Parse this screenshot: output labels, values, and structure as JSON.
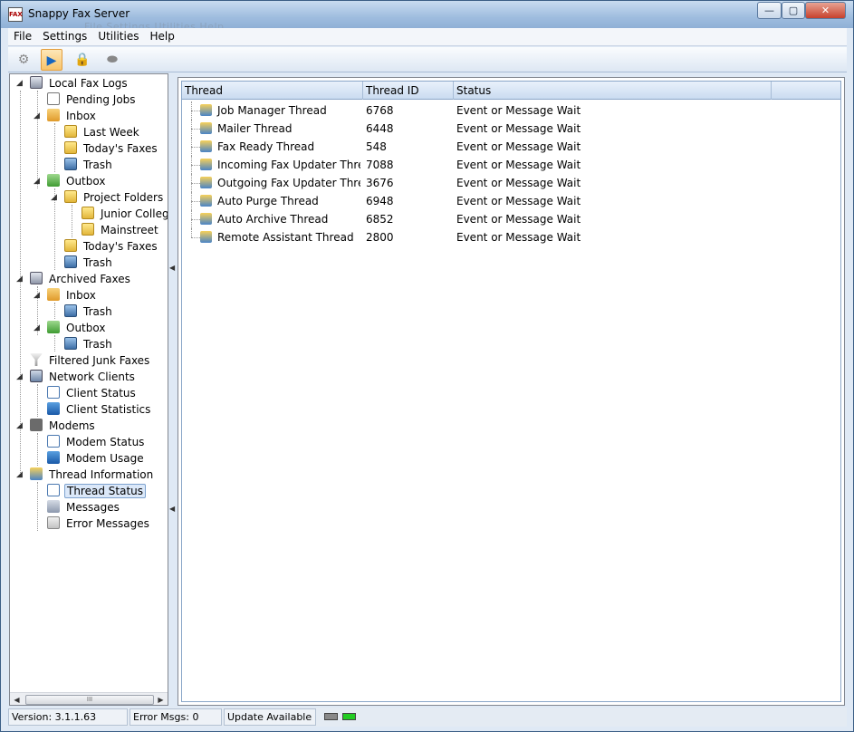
{
  "window": {
    "title": "Snappy Fax Server",
    "icon": "fax-icon",
    "title_ghost": "File  Settings  Utilities  Help"
  },
  "menu": [
    "File",
    "Settings",
    "Utilities",
    "Help"
  ],
  "toolbar": [
    {
      "icon": "gear-icon",
      "glyph": "⚙"
    },
    {
      "icon": "play-icon",
      "glyph": "▶"
    },
    {
      "icon": "lock-icon",
      "glyph": "🔒"
    },
    {
      "icon": "modem-icon",
      "glyph": "⬬"
    }
  ],
  "tree": [
    {
      "label": "Local Fax Logs",
      "icon": "database-icon"
    },
    {
      "label": "Pending Jobs",
      "icon": "pending-jobs-icon"
    },
    {
      "label": "Inbox",
      "icon": "inbox-icon"
    },
    {
      "label": "Last Week",
      "icon": "folder-lock-icon"
    },
    {
      "label": "Today's Faxes",
      "icon": "folder-icon"
    },
    {
      "label": "Trash",
      "icon": "trash-icon"
    },
    {
      "label": "Outbox",
      "icon": "outbox-icon"
    },
    {
      "label": "Project Folders",
      "icon": "folder-icon"
    },
    {
      "label": "Junior College",
      "icon": "folder-icon"
    },
    {
      "label": "Mainstreet",
      "icon": "folder-icon"
    },
    {
      "label": "Today's Faxes",
      "icon": "folder-icon"
    },
    {
      "label": "Trash",
      "icon": "trash-icon"
    },
    {
      "label": "Archived Faxes",
      "icon": "database-icon"
    },
    {
      "label": "Inbox",
      "icon": "inbox-icon"
    },
    {
      "label": "Trash",
      "icon": "trash-icon"
    },
    {
      "label": "Outbox",
      "icon": "outbox-icon"
    },
    {
      "label": "Trash",
      "icon": "trash-icon"
    },
    {
      "label": "Filtered Junk Faxes",
      "icon": "filter-icon"
    },
    {
      "label": "Network Clients",
      "icon": "network-icon"
    },
    {
      "label": "Client Status",
      "icon": "status-icon"
    },
    {
      "label": "Client Statistics",
      "icon": "statistics-icon"
    },
    {
      "label": "Modems",
      "icon": "modem-icon"
    },
    {
      "label": "Modem  Status",
      "icon": "status-icon"
    },
    {
      "label": "Modem  Usage",
      "icon": "statistics-icon"
    },
    {
      "label": "Thread Information",
      "icon": "thread-icon"
    },
    {
      "label": "Thread Status",
      "icon": "status-icon"
    },
    {
      "label": "Messages",
      "icon": "messages-icon"
    },
    {
      "label": "Error Messages",
      "icon": "error-messages-icon"
    }
  ],
  "table": {
    "headers": [
      "Thread",
      "Thread ID",
      "Status"
    ],
    "rows": [
      {
        "thread": "Job Manager Thread",
        "id": "6768",
        "status": "Event or Message Wait"
      },
      {
        "thread": "Mailer Thread",
        "id": "6448",
        "status": "Event or Message Wait"
      },
      {
        "thread": "Fax Ready Thread",
        "id": "548",
        "status": "Event or Message Wait"
      },
      {
        "thread": "Incoming Fax Updater Thread",
        "id": "7088",
        "status": "Event or Message Wait"
      },
      {
        "thread": "Outgoing Fax Updater Thread",
        "id": "3676",
        "status": "Event or Message Wait"
      },
      {
        "thread": "Auto Purge Thread",
        "id": "6948",
        "status": "Event or Message Wait"
      },
      {
        "thread": "Auto Archive Thread",
        "id": "6852",
        "status": "Event or Message Wait"
      },
      {
        "thread": "Remote Assistant Thread",
        "id": "2800",
        "status": "Event or Message Wait"
      }
    ]
  },
  "status": {
    "version": "Version: 3.1.1.63",
    "errors": "Error Msgs: 0",
    "update": "Update Available"
  },
  "scroll": {
    "grip": "III",
    "left_arrow": "◀",
    "right_arrow": "▶"
  },
  "window_buttons": {
    "minimize": "—",
    "maximize": "▢",
    "close": "✕"
  },
  "colors": {
    "led_off": "#888888",
    "led_on": "#22cc22",
    "selected_border": "#7da2ce"
  }
}
